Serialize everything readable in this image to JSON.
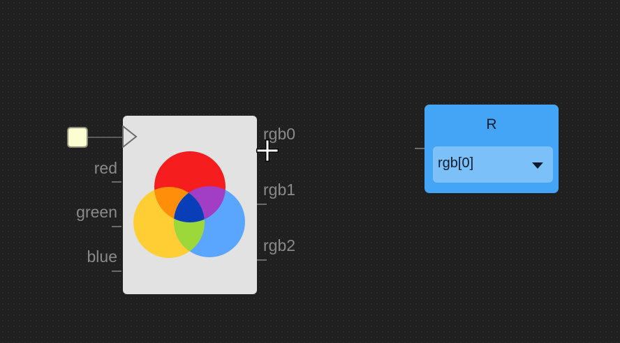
{
  "mixer_node": {
    "inputs": [
      "red",
      "green",
      "blue"
    ],
    "outputs": [
      "rgb0",
      "rgb1",
      "rgb2"
    ]
  },
  "channel_node": {
    "title": "R",
    "selected_option": "rgb[0]"
  },
  "colors": {
    "canvas_background": "#202020",
    "toggle_fill": "#fdfdd2",
    "mixer_node_background": "#e2e2e2",
    "channel_node_background": "#44a4f6",
    "channel_select_background": "#7cc0fa",
    "venn_red": "#f51d1d",
    "venn_yellow": "#ffce34",
    "venn_blue": "#5aa6ff",
    "venn_orange": "#ff8f0a",
    "venn_purple": "#a13ec5",
    "venn_green": "#9cd83a",
    "venn_center": "#083fb8"
  },
  "icons": {
    "toggle": "toggle-swatch-icon",
    "clock_pin": "triangle-input-icon",
    "venn": "rgb-venn-icon",
    "cursor": "crosshair-cursor-icon",
    "caret": "caret-down-icon"
  }
}
